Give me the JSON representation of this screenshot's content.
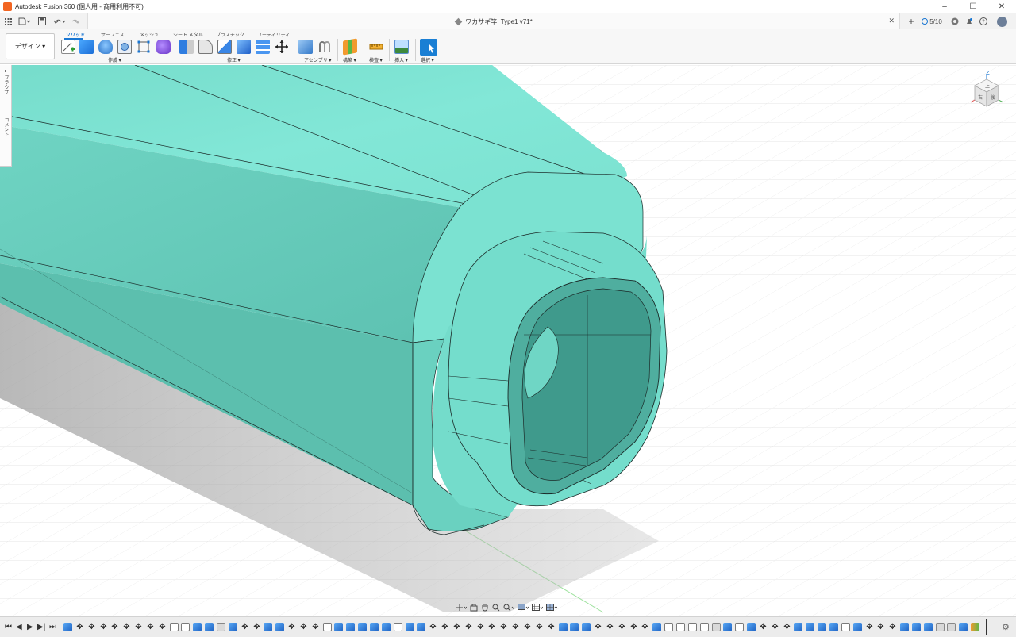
{
  "window": {
    "title": "Autodesk Fusion 360 (個人用 - 商用利用不可)",
    "controls": {
      "minimize": "–",
      "maximize": "☐",
      "close": "✕"
    }
  },
  "tabbar": {
    "document_tab": "ワカサギ竿_Type1 v71*",
    "close_glyph": "✕",
    "new_tab_glyph": "+",
    "jobs_status": "5/10"
  },
  "ribbon": {
    "workspace_button": "デザイン ▾",
    "tabs": [
      "ソリッド",
      "サーフェス",
      "メッシュ",
      "シート メタル",
      "プラスチック",
      "ユーティリティ"
    ],
    "active_tab": "ソリッド",
    "groups": [
      "作成 ▾",
      "修正 ▾",
      "アセンブリ ▾",
      "構築 ▾",
      "検査 ▾",
      "挿入 ▾",
      "選択 ▾"
    ]
  },
  "browser": {
    "label_top": "▸ ブラウザ",
    "label_bottom": "コメント"
  },
  "viewcube": {
    "top_face": "上",
    "front_face": "右",
    "side_face": "後",
    "axis_label": "Z"
  },
  "colors": {
    "model_face": "#7de3d3",
    "model_face_dark": "#5ec3b4",
    "edge": "#1b2a28",
    "accent": "#1976d2",
    "grid": "#e5e5e5"
  },
  "timeline_controls": [
    "⏮",
    "◀",
    "▶",
    "▶|",
    "⏭"
  ],
  "settings_glyph": "⚙"
}
